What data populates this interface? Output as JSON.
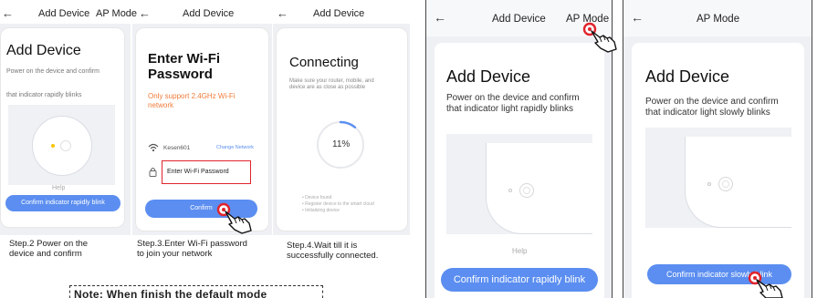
{
  "screen1": {
    "header_title": "Add Device",
    "header_right": "AP Mode",
    "title": "Add Device",
    "subtitle_line1": "Power on the device and confirm",
    "subtitle_line2": "that indicator rapidly blinks",
    "help": "Help",
    "confirm_button": "Confirm indicator rapidly blink",
    "caption_line1": "Step.2 Power on the",
    "caption_line2": "device and confirm"
  },
  "screen2": {
    "header_title": "Add Device",
    "title_line1": "Enter Wi-Fi",
    "title_line2": "Password",
    "warning_line1": "Only support 2.4GHz Wi-Fi",
    "warning_line2": "network",
    "network_name": "Kesen601",
    "change_network": "Change Network",
    "password_placeholder": "Enter Wi-Fi Password",
    "confirm_button": "Confirm",
    "caption_line1": "Step.3.Enter Wi-Fi password",
    "caption_line2": "to join your network"
  },
  "screen3": {
    "title": "Connecting",
    "subtitle_line1": "Make sure your router, mobile, and",
    "subtitle_line2": "device are as close as possible",
    "progress_label": "11%",
    "progress_value": 11,
    "check_1": "Device found",
    "check_2": "Register device to the smart cloud",
    "check_3": "Initializing device",
    "caption_line1": "Step.4.Wait till it is",
    "caption_line2": "successfully connected."
  },
  "screen4": {
    "header_title": "Add Device",
    "header_right": "AP Mode",
    "title": "Add Device",
    "subtitle_line1": "Power on the device and confirm",
    "subtitle_line2": "that indicator light rapidly blinks",
    "help": "Help",
    "confirm_button": "Confirm indicator rapidly blink"
  },
  "screen5": {
    "header_title": "AP Mode",
    "title": "Add Device",
    "subtitle_line1": "Power on the device and confirm",
    "subtitle_line2": "that indicator light slowly blinks",
    "confirm_button": "Confirm indicator slowly blink"
  },
  "note": "Note: When finish the default mode",
  "icons": {
    "back": "←",
    "accent": "#5b8ef0",
    "warning": "#f07c3a",
    "highlight": "#e0242c"
  }
}
